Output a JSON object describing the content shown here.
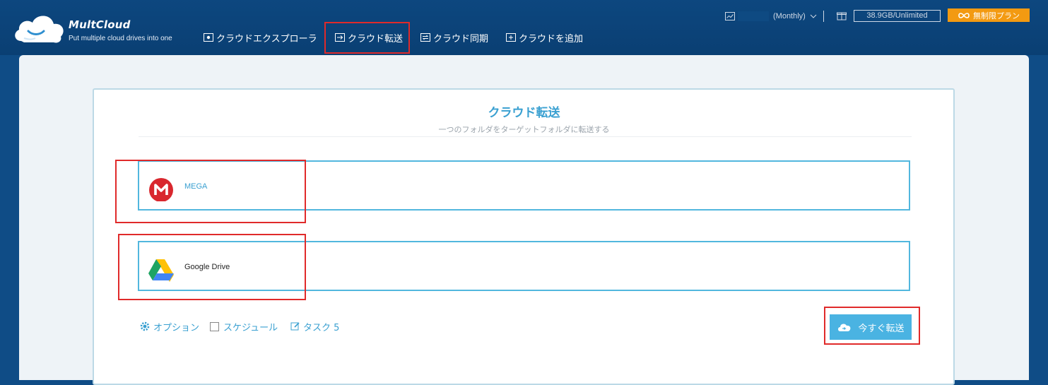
{
  "header": {
    "brand": "MultCloud",
    "tagline": "Put multiple cloud drives into one",
    "nav": [
      {
        "label": "クラウドエクスプローラ"
      },
      {
        "label": "クラウド転送"
      },
      {
        "label": "クラウド同期"
      },
      {
        "label": "クラウドを追加"
      }
    ],
    "account_plan": "(Monthly)",
    "storage": "38.9GB/Unlimited",
    "upgrade_label": "無制限プラン"
  },
  "main": {
    "title": "クラウド転送",
    "subtitle": "一つのフォルダをターゲットフォルダに転送する",
    "source": {
      "name": "MEGA"
    },
    "target": {
      "name": "Google Drive"
    },
    "options": {
      "option_label": "オプション",
      "schedule_label": "スケジュール",
      "task_label": "タスク 5"
    },
    "transfer_button": "今すぐ転送"
  },
  "colors": {
    "accent": "#3aa0d1",
    "header_bg": "#0d477f",
    "highlight": "#e02a2a",
    "plan_orange": "#f39a11",
    "mega_red": "#d9272e"
  }
}
